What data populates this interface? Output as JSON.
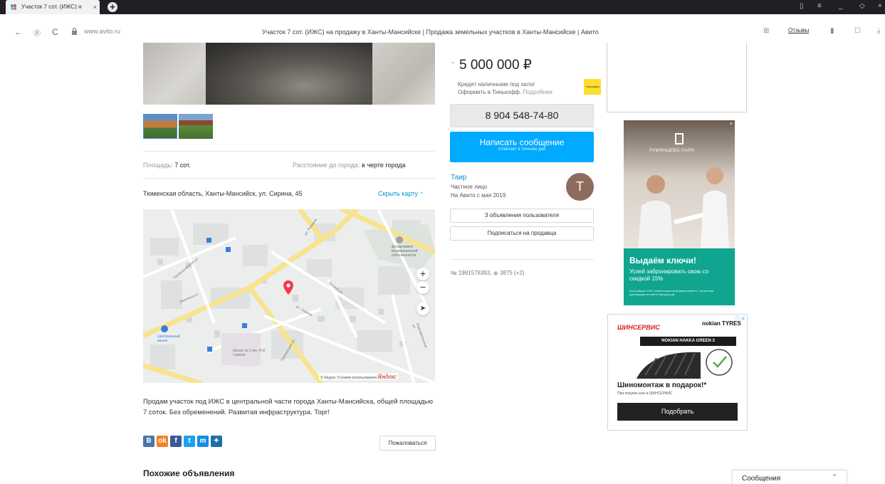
{
  "browser": {
    "tab_title": "Участок 7 сот. (ИЖС) н",
    "tab_close": "×",
    "new_tab": "+",
    "url": "www.avito.ru",
    "page_title": "Участок 7 сот. (ИЖС) на продажу в Ханты-Мансийске | Продажа земельных участков в Ханты-Мансийске | Авито",
    "reviews_label": "Отзывы",
    "nav_back": "←",
    "nav_reload": "C"
  },
  "listing": {
    "area_label": "Площадь:",
    "area_value": "7 сот.",
    "distance_label": "Расстояние до города:",
    "distance_value": "в черте города",
    "address": "Тюменская область, Ханты-Мансийск, ул. Сирина, 45",
    "hide_map": "Скрыть карту",
    "description": "Продам участок под ИЖС в центральной части города Ханты-Мансийска, общей площадью 7 соток. Без обременений. Развитая инфраструктура. Торг!",
    "complain": "Пожаловаться",
    "similar_title": "Похожие объявления"
  },
  "map": {
    "zoom_in": "+",
    "zoom_out": "−",
    "footer": "© Яндекс Условия использования",
    "yandex": "Яндекс",
    "labels": {
      "dept": "Департамент муниципальной собственности",
      "market": "Центральный рынок",
      "school": "Школа № 3 им. Н.И. Сирина",
      "street1": "ул. Рознина",
      "street2": "ул. Сирина",
      "street3": "Пионерская ул.",
      "street4": "Комсомольская ул.",
      "street5": "Промышленная ул.",
      "street6": "Ленина ул.",
      "street7": "Энгельса ул."
    }
  },
  "sidebar": {
    "price": "5 000 000 ₽",
    "credit_line1": "Кредит наличными под залог",
    "credit_line2": "Оформить в Тинькофф.",
    "credit_more": "Подробнее",
    "tinkoff_label": "Тинькофф",
    "phone": "8 904 548-74-80",
    "message_btn": "Написать сообщение",
    "message_sub": "Отвечает в течение дня",
    "seller_name": "Таир",
    "seller_type": "Частное лицо",
    "seller_since": "На Авито с мая 2019",
    "avatar_letter": "T",
    "user_ads_btn": "3 объявления пользователя",
    "subscribe_btn": "Подписаться на продавца",
    "ad_id": "№ 1981576393,",
    "views": "3875 (+2)"
  },
  "ad1": {
    "brand": "РУМЯНЦЕВО-ПАРК",
    "headline": "Выдаём ключи!",
    "sub": "Успей забронировать свою со скидкой 15%",
    "fine": "Застройщик ООО «Инвестиционный Девелопмент». Проектная декларация на сайте наш.дом.рф",
    "close": "×"
  },
  "ad2": {
    "shinservis": "ШИНСЕРВИС",
    "nokian": "nokian TYRES",
    "band": "NOKIAN HAKKA GREEN 3",
    "headline": "Шиномонтаж в подарок!*",
    "sub": "При покупке шин в ШИНСЕРВИС",
    "button": "Подобрать",
    "adtag": "ⓘ X"
  },
  "chat": {
    "label": "Сообщения",
    "chevron": "⌃"
  },
  "share": [
    "В",
    "ok",
    "f",
    "t",
    "m",
    "✦"
  ],
  "colors": {
    "accent": "#00aaff",
    "link": "#0091d9",
    "ad_teal": "#0fa58f"
  }
}
